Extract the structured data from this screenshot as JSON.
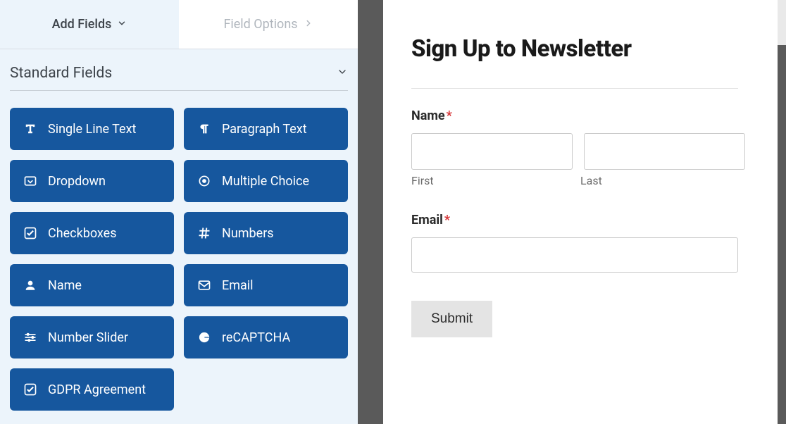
{
  "tabs": {
    "add_fields": "Add Fields",
    "field_options": "Field Options"
  },
  "section": {
    "title": "Standard Fields"
  },
  "fields": {
    "single_line_text": "Single Line Text",
    "paragraph_text": "Paragraph Text",
    "dropdown": "Dropdown",
    "multiple_choice": "Multiple Choice",
    "checkboxes": "Checkboxes",
    "numbers": "Numbers",
    "name": "Name",
    "email": "Email",
    "number_slider": "Number Slider",
    "recaptcha": "reCAPTCHA",
    "gdpr": "GDPR Agreement"
  },
  "preview": {
    "title": "Sign Up to Newsletter",
    "name_label": "Name",
    "first_sub": "First",
    "last_sub": "Last",
    "email_label": "Email",
    "submit": "Submit",
    "required_mark": "*"
  }
}
